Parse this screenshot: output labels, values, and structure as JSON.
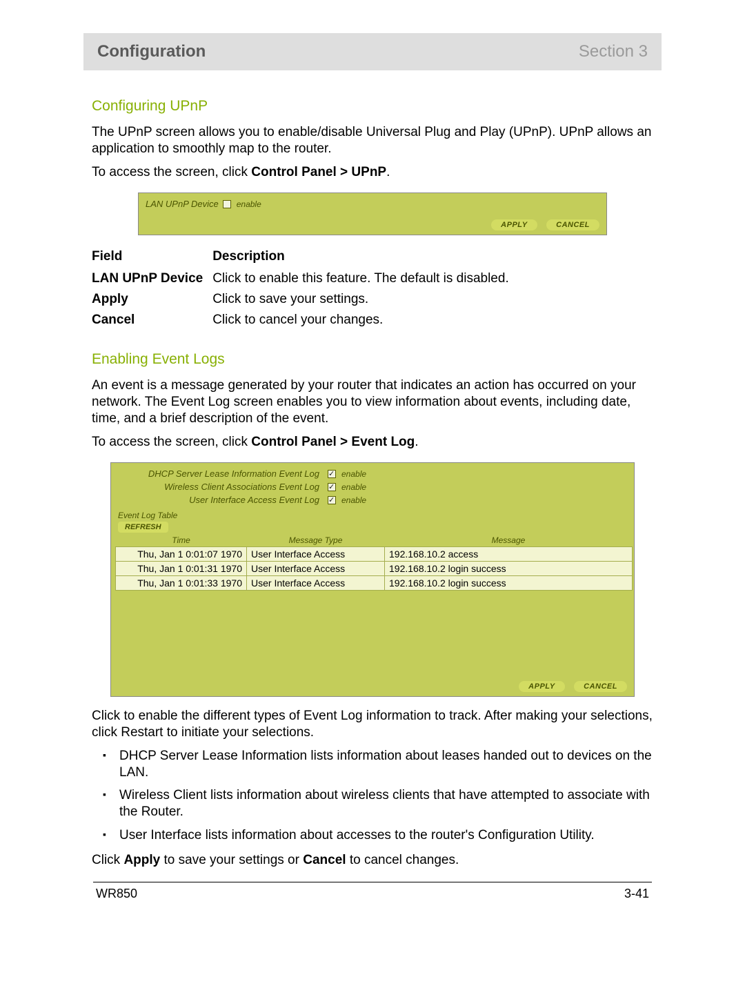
{
  "header": {
    "title": "Configuration",
    "section": "Section 3"
  },
  "upnp": {
    "heading": "Configuring UPnP",
    "intro": "The UPnP screen allows you to enable/disable Universal Plug and Play (UPnP). UPnP allows an application to smoothly map to the router.",
    "access_pre": "To access the screen, click ",
    "access_bold": "Control Panel > UPnP",
    "access_post": ".",
    "panel": {
      "label": "LAN UPnP Device",
      "enable": "enable",
      "checked": false,
      "apply": "APPLY",
      "cancel": "CANCEL"
    },
    "table": {
      "hdr_field": "Field",
      "hdr_desc": "Description",
      "rows": [
        {
          "field": "LAN UPnP Device",
          "desc": "Click to enable this feature. The default is disabled."
        },
        {
          "field": "Apply",
          "desc": "Click to save your settings."
        },
        {
          "field": "Cancel",
          "desc": "Click to cancel your changes."
        }
      ]
    }
  },
  "eventlog": {
    "heading": "Enabling Event Logs",
    "intro": "An event is a message generated by your router that indicates an action has occurred on your network. The Event Log screen enables you to view information about events, including date, time, and a brief description of the event.",
    "access_pre": "To access the screen, click ",
    "access_bold": "Control Panel > Event Log",
    "access_post": ".",
    "panel": {
      "opts": [
        {
          "label": "DHCP Server Lease Information Event Log",
          "enable": "enable",
          "checked": true
        },
        {
          "label": "Wireless Client Associations Event Log",
          "enable": "enable",
          "checked": true
        },
        {
          "label": "User Interface Access Event Log",
          "enable": "enable",
          "checked": true
        }
      ],
      "caption": "Event Log Table",
      "refresh": "REFRESH",
      "columns": {
        "time": "Time",
        "type": "Message Type",
        "msg": "Message"
      },
      "rows": [
        {
          "time": "Thu, Jan 1 0:01:07 1970",
          "type": "User Interface Access",
          "msg": "192.168.10.2 access"
        },
        {
          "time": "Thu, Jan 1 0:01:31 1970",
          "type": "User Interface Access",
          "msg": "192.168.10.2 login success"
        },
        {
          "time": "Thu, Jan 1 0:01:33 1970",
          "type": "User Interface Access",
          "msg": "192.168.10.2 login success"
        }
      ],
      "apply": "APPLY",
      "cancel": "CANCEL"
    },
    "after": "Click to enable the different types of Event Log information to track. After making your selections, click Restart to initiate your selections.",
    "bullets": [
      "DHCP Server Lease Information lists information about leases handed out to devices on the LAN.",
      "Wireless Client lists information about wireless clients that have attempted to associate with the Router.",
      "User Interface lists information about accesses to the router's Configuration Utility."
    ],
    "closing_pre": "Click ",
    "closing_b1": "Apply",
    "closing_mid": " to save your settings or ",
    "closing_b2": "Cancel",
    "closing_post": " to cancel changes."
  },
  "footer": {
    "model": "WR850",
    "page": "3-41"
  }
}
